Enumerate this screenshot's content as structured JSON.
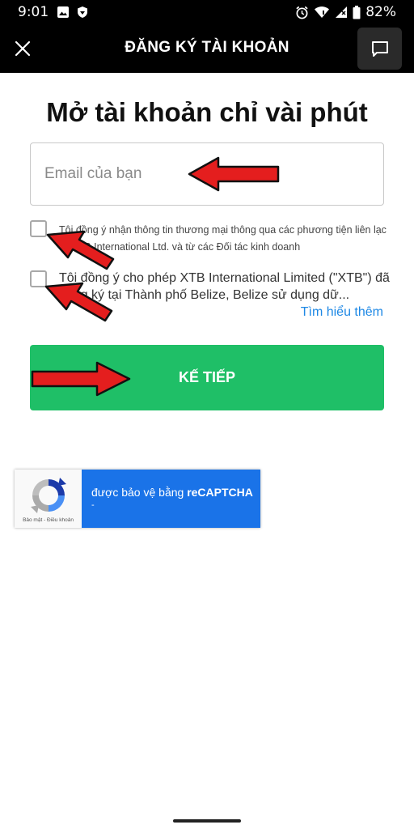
{
  "status_bar": {
    "time": "9:01",
    "battery": "82%"
  },
  "app_bar": {
    "title": "ĐĂNG KÝ TÀI KHOẢN"
  },
  "main": {
    "heading": "Mở tài khoản chỉ vài phút",
    "email_placeholder": "Email của bạn",
    "consent_1": "Tôi đồng ý nhận thông tin thương mại thông qua các phương tiện liên lạc từ XTB International Ltd. và từ các Đối tác kinh doanh",
    "consent_2": "Tôi đồng ý cho phép XTB International Limited (\"XTB\") đã đăng ký tại Thành phố Belize, Belize sử dụng dữ...",
    "learn_more": "Tìm hiểu thêm",
    "next_button": "KẾ TIẾP"
  },
  "recaptcha": {
    "protected_prefix": "được bảo vệ bằng ",
    "brand": "reCAPTCHA",
    "sub": "-",
    "links": "Bảo mật - Điều khoản"
  },
  "colors": {
    "accent_green": "#1fbf67",
    "link_blue": "#1e88e5",
    "recaptcha_blue": "#1a73e8",
    "annotation_red": "#e41e1e"
  }
}
